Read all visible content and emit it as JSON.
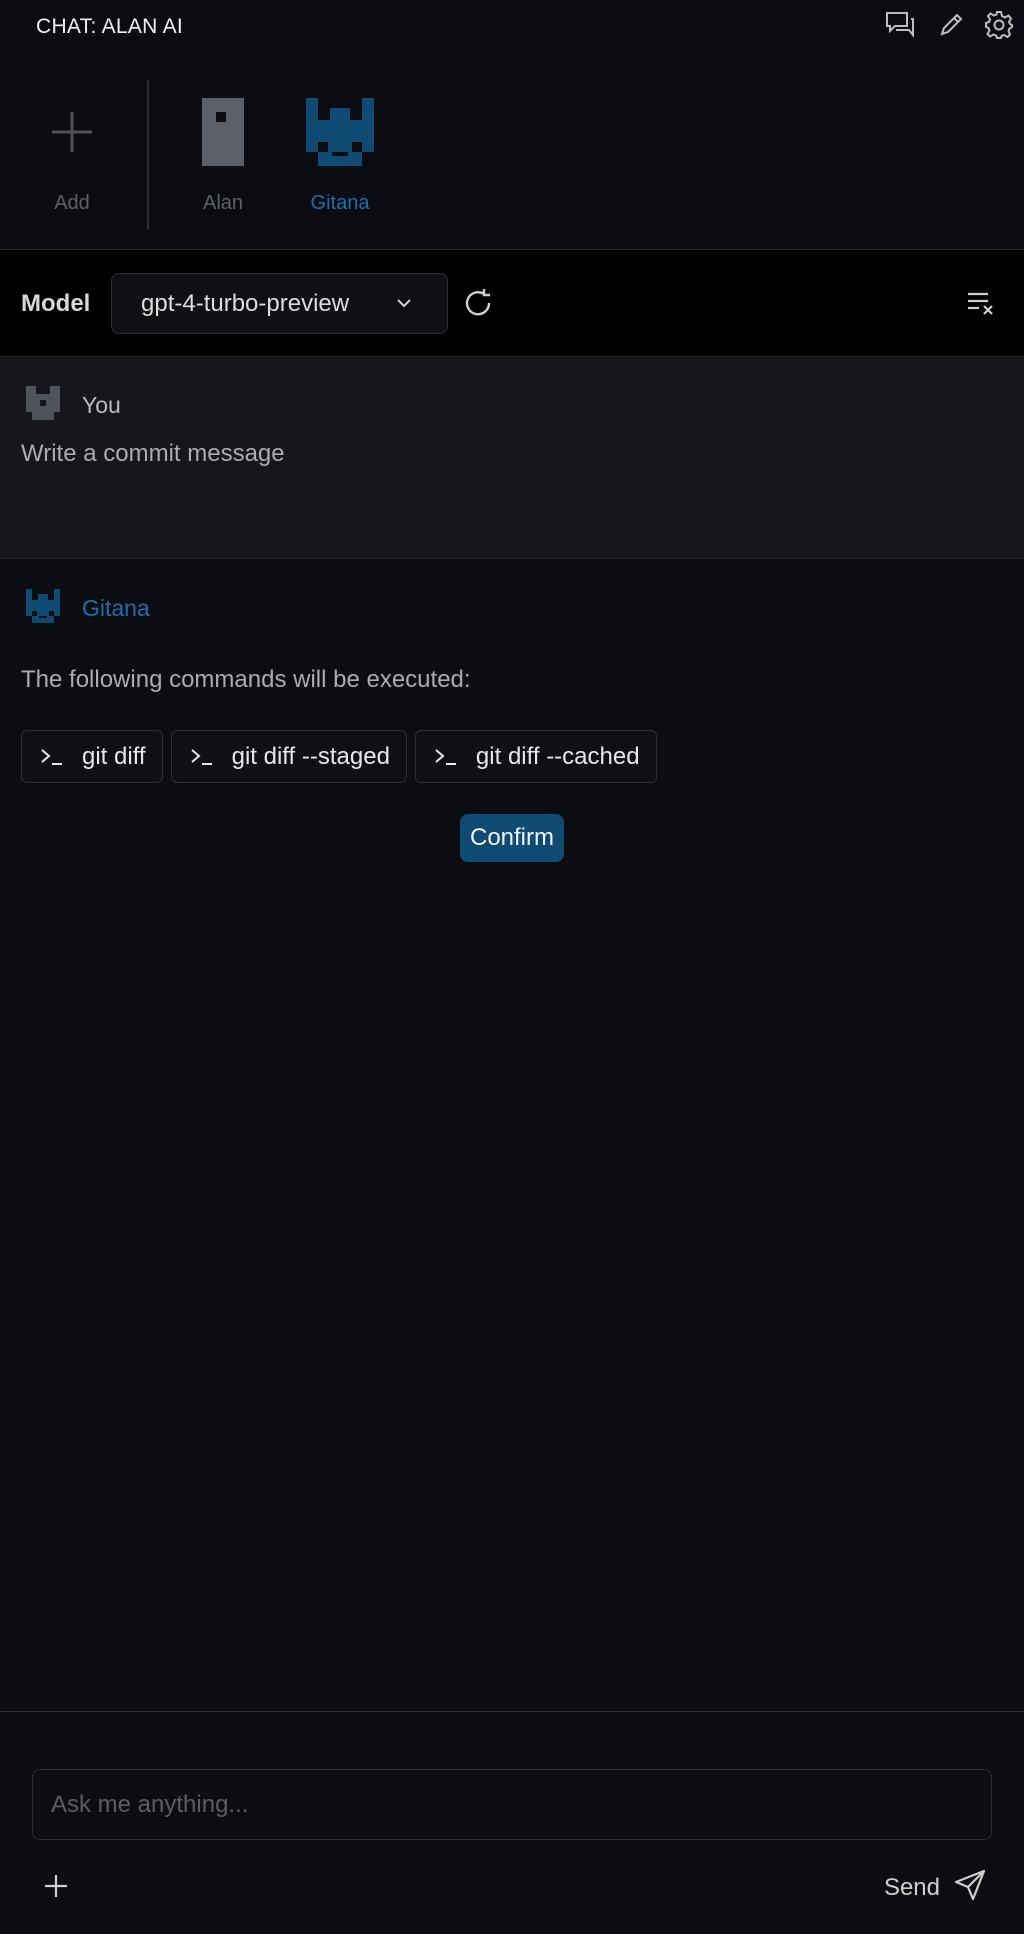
{
  "titlebar": {
    "title": "CHAT: ALAN AI",
    "actions": [
      {
        "icon": "chat-icon",
        "active": true
      },
      {
        "icon": "pencil-icon",
        "active": false
      },
      {
        "icon": "gear-icon",
        "active": false
      }
    ]
  },
  "agents": [
    {
      "label": "Add",
      "icon": "plus-icon"
    },
    {
      "label": "Alan",
      "icon": "alan-avatar-icon"
    },
    {
      "label": "Gitana",
      "icon": "gitana-avatar-icon",
      "active": true
    }
  ],
  "model_bar": {
    "label": "Model",
    "selected_model": "gpt-4-turbo-preview"
  },
  "messages": [
    {
      "author": "You",
      "text": "Write a commit message"
    },
    {
      "author": "Gitana",
      "intro": "The following commands will be executed:",
      "commands": [
        "git diff",
        "git diff --staged",
        "git diff --cached"
      ],
      "confirm_label": "Confirm"
    }
  ],
  "composer": {
    "placeholder": "Ask me anything...",
    "send_label": "Send"
  },
  "colors": {
    "accent": "#1f6fa6",
    "confirm_bg": "#0f4a72",
    "background": "#0b0d12"
  }
}
